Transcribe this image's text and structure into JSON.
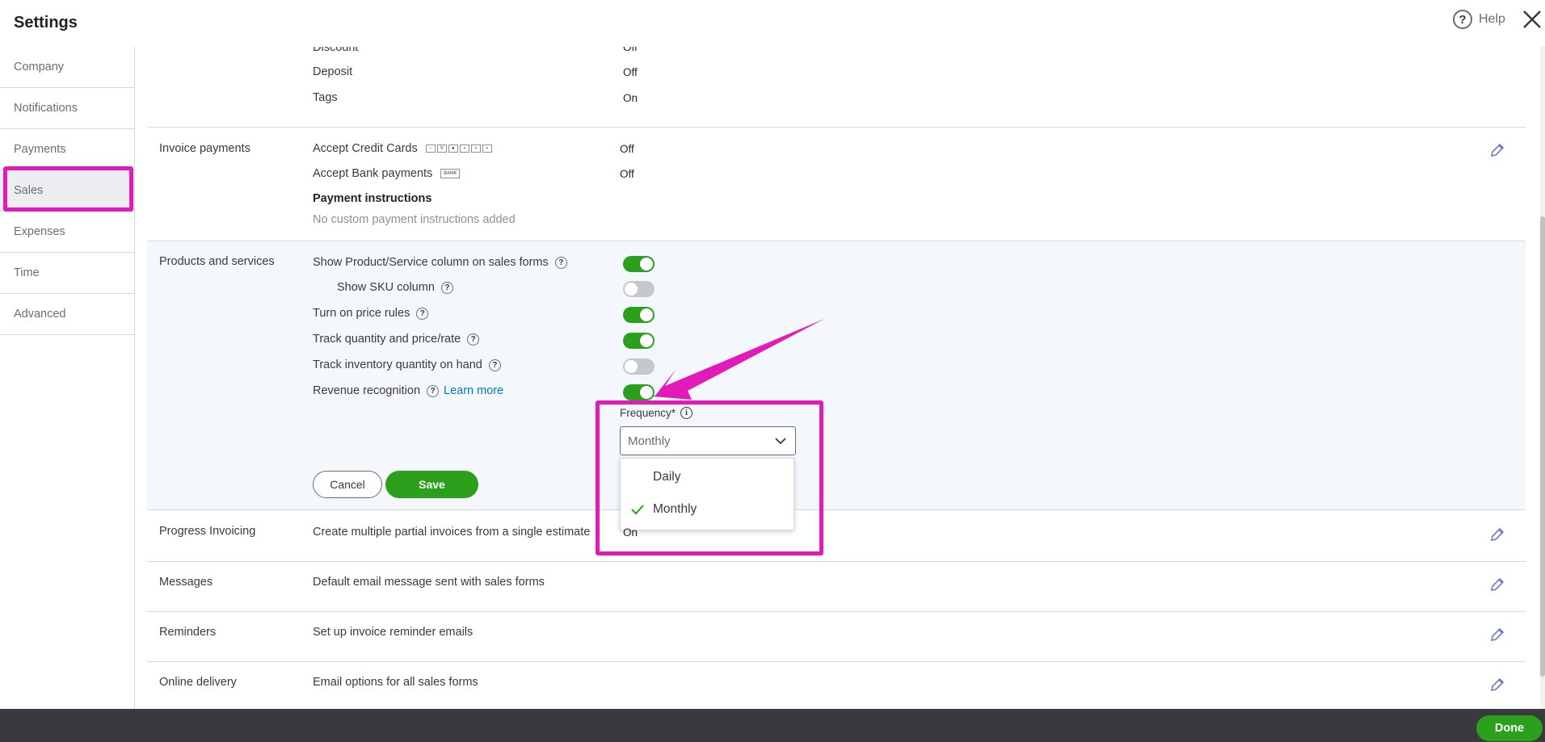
{
  "header": {
    "title": "Settings",
    "help_label": "Help"
  },
  "sidebar": {
    "items": [
      {
        "label": "Company"
      },
      {
        "label": "Notifications"
      },
      {
        "label": "Payments"
      },
      {
        "label": "Sales",
        "active": true
      },
      {
        "label": "Expenses"
      },
      {
        "label": "Time"
      },
      {
        "label": "Advanced"
      }
    ]
  },
  "top_section": {
    "items": [
      {
        "label": "Discount",
        "value": "Off"
      },
      {
        "label": "Deposit",
        "value": "Off"
      },
      {
        "label": "Tags",
        "value": "On"
      }
    ]
  },
  "invoice_payments": {
    "label": "Invoice payments",
    "credit_cards": {
      "label": "Accept Credit Cards",
      "value": "Off"
    },
    "bank_payments": {
      "label": "Accept Bank payments",
      "value": "Off",
      "badge": "BANK"
    },
    "instructions_title": "Payment instructions",
    "instructions_text": "No custom payment instructions added"
  },
  "products_services": {
    "label": "Products and services",
    "settings": [
      {
        "label": "Show Product/Service column on sales forms",
        "on": true
      },
      {
        "label": "Show SKU column",
        "on": false
      },
      {
        "label": "Turn on price rules",
        "on": true
      },
      {
        "label": "Track quantity and price/rate",
        "on": true
      },
      {
        "label": "Track inventory quantity on hand",
        "on": false
      },
      {
        "label": "Revenue recognition",
        "on": true,
        "link": "Learn more"
      }
    ],
    "frequency": {
      "label": "Frequency*",
      "selected": "Monthly",
      "options": [
        {
          "label": "Daily",
          "checked": false
        },
        {
          "label": "Monthly",
          "checked": true
        }
      ]
    },
    "cancel_label": "Cancel",
    "save_label": "Save"
  },
  "progress_invoicing": {
    "label": "Progress Invoicing",
    "text": "Create multiple partial invoices from a single estimate",
    "value": "On"
  },
  "messages": {
    "label": "Messages",
    "text": "Default email message sent with sales forms"
  },
  "reminders": {
    "label": "Reminders",
    "text": "Set up invoice reminder emails"
  },
  "online_delivery": {
    "label": "Online delivery",
    "text": "Email options for all sales forms"
  },
  "footer": {
    "done_label": "Done"
  },
  "colors": {
    "accent_green": "#2ca01c",
    "highlight_magenta": "#e21ab8",
    "link_blue": "#0077c5"
  }
}
